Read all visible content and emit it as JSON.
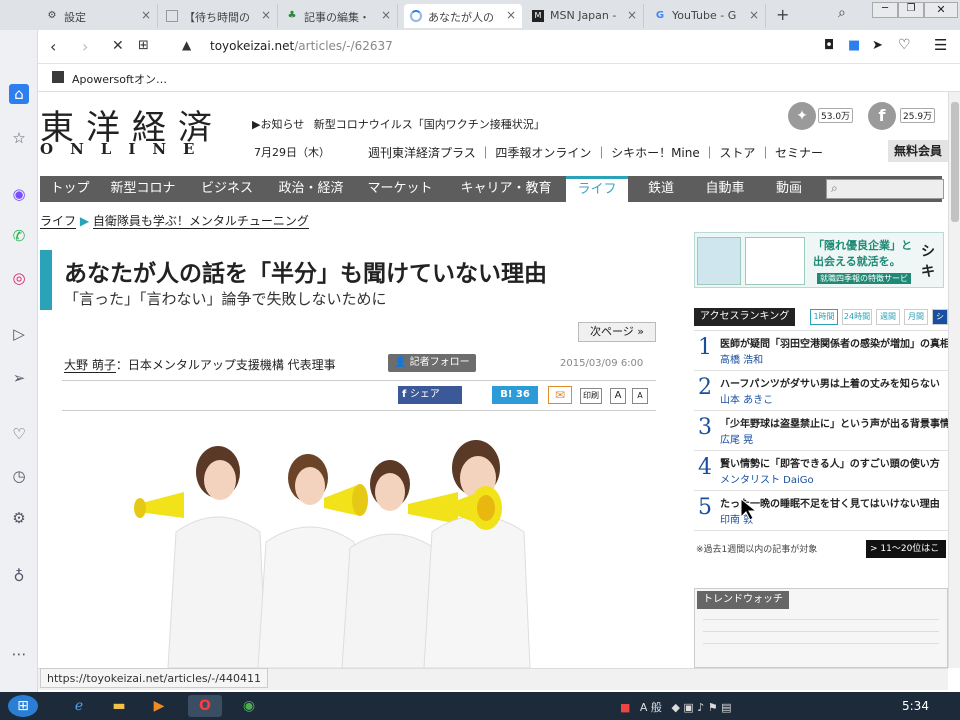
{
  "browser": {
    "tabs": [
      {
        "label": "設定",
        "icon": "gear-icon",
        "active": false
      },
      {
        "label": "【待ち時間の",
        "icon": "note-icon",
        "active": false
      },
      {
        "label": "記事の編集・",
        "icon": "edit-icon",
        "active": false
      },
      {
        "label": "あなたが人の",
        "icon": "loading-icon",
        "active": true
      },
      {
        "label": "MSN Japan -",
        "icon": "msn-icon",
        "active": false
      },
      {
        "label": "YouTube - G",
        "icon": "google-icon",
        "active": false
      }
    ],
    "new_tab": "+",
    "url_domain": "toyokeizai.net",
    "url_path": "/articles/-/62637",
    "bookmark": "Apowersoftオン…",
    "status_url": "https://toyokeizai.net/articles/-/440411"
  },
  "header": {
    "logo_kanji": "東洋経済",
    "logo_online": "ONLINE",
    "notice_label": "▶お知らせ",
    "notice_text": "新型コロナウイルス「国内ワクチン接種状況」",
    "date": "7月29日（木）",
    "links": [
      "週刊東洋経済プラス",
      "四季報オンライン",
      "シキホー！Mine",
      "ストア",
      "セミナー"
    ],
    "twitter_count": "53.0万",
    "facebook_count": "25.9万",
    "member_button": "無料会員"
  },
  "nav": {
    "items": [
      "トップ",
      "新型コロナ",
      "ビジネス",
      "政治・経済",
      "マーケット",
      "キャリア・教育",
      "ライフ",
      "鉄道",
      "自動車",
      "動画"
    ],
    "active_index": 6
  },
  "breadcrumb": {
    "root": "ライフ",
    "current": "自衛隊員も学ぶ！メンタルチューニング"
  },
  "article": {
    "title": "あなたが人の話を「半分」も聞けていない理由",
    "subtitle": "「言った」「言わない」論争で失敗しないために",
    "next_page": "次ページ »",
    "author": "大野 萌子",
    "author_role": "：日本メンタルアップ支援機構 代表理事",
    "follow_button": "記者フォロー",
    "date": "2015/03/09 6:00",
    "share_button": "シェア",
    "bookmark_count": "B! 36",
    "print_label": "印刷",
    "font_large": "A",
    "font_small": "A"
  },
  "sidebar": {
    "ad_text1": "「隠れ優良企業」と",
    "ad_text2": "出会える就活を。",
    "ad_brand": "シキ",
    "ad_caption": "就職四季報の特徴サービ",
    "ranking_title": "アクセスランキング",
    "ranking_tabs": [
      "1時間",
      "24時間",
      "週間",
      "月間",
      "シ"
    ],
    "ranking": [
      {
        "num": "1",
        "title": "医師が疑問「羽田空港関係者の感染が増加」の真相",
        "author": "高橋 浩和"
      },
      {
        "num": "2",
        "title": "ハーフパンツがダサい男は上着の丈みを知らない",
        "author": "山本 あきこ"
      },
      {
        "num": "3",
        "title": "「少年野球は盗塁禁止に」という声が出る背景事情",
        "author": "広尾 晃"
      },
      {
        "num": "4",
        "title": "賢い情勢に「即答できる人」のすごい頭の使い方",
        "author": "メンタリスト DaiGo"
      },
      {
        "num": "5",
        "title": "たった一晩の睡眠不足を甘く見てはいけない理由",
        "author": "印南 敦"
      }
    ],
    "ranking_note": "※過去1週間以内の記事が対象",
    "ranking_more": "> 11～20位はこ",
    "trend_title": "トレンドウォッチ"
  },
  "taskbar": {
    "ime": "A 般",
    "time": "5:34"
  },
  "colors": {
    "accent": "#2aa3b8",
    "nav_bg": "#5d5d5d",
    "link": "#1a4fa0",
    "megaphone": "#f2e21a"
  }
}
